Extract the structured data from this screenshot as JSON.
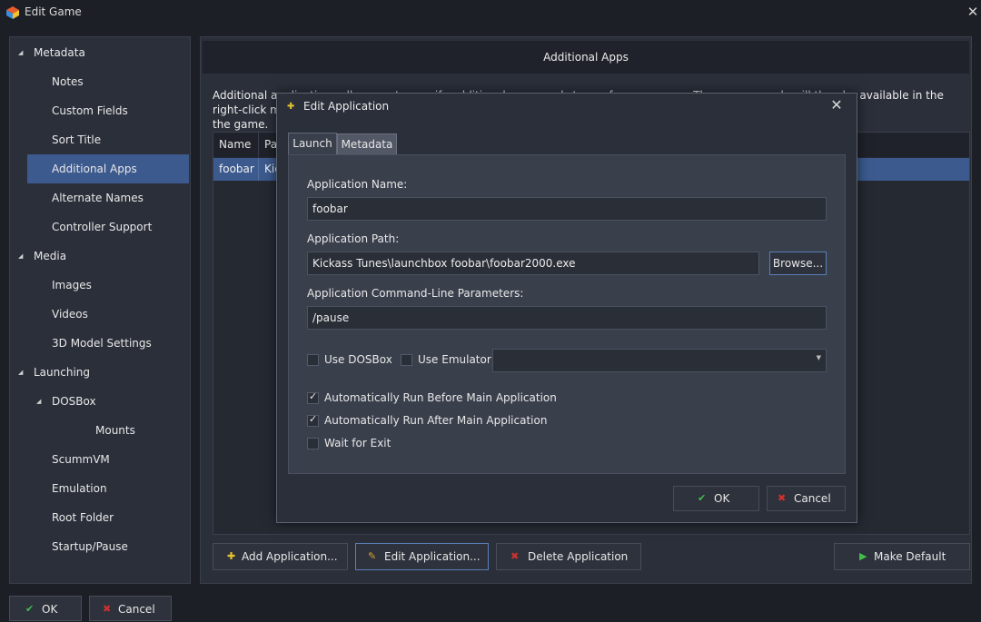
{
  "window": {
    "title": "Edit Game",
    "close_glyph": "✕"
  },
  "sidebar": {
    "items": [
      {
        "label": "Metadata",
        "expanded": true,
        "level": 0
      },
      {
        "label": "Notes",
        "level": 1
      },
      {
        "label": "Custom Fields",
        "level": 1
      },
      {
        "label": "Sort Title",
        "level": 1
      },
      {
        "label": "Additional Apps",
        "level": 1,
        "selected": true
      },
      {
        "label": "Alternate Names",
        "level": 1
      },
      {
        "label": "Controller Support",
        "level": 1
      },
      {
        "label": "Media",
        "expanded": true,
        "level": 0
      },
      {
        "label": "Images",
        "level": 1
      },
      {
        "label": "Videos",
        "level": 1
      },
      {
        "label": "3D Model Settings",
        "level": 1
      },
      {
        "label": "Launching",
        "expanded": true,
        "level": 0
      },
      {
        "label": "DOSBox",
        "expanded": true,
        "level": 1
      },
      {
        "label": "Mounts",
        "level": 2
      },
      {
        "label": "ScummVM",
        "level": 1
      },
      {
        "label": "Emulation",
        "level": 1
      },
      {
        "label": "Root Folder",
        "level": 1
      },
      {
        "label": "Startup/Pause",
        "level": 1
      }
    ]
  },
  "main": {
    "header": "Additional Apps",
    "intro_line1": "Additional applications allow you to specify additional commands to run for your game. These commands will then be available in the right-click menu for",
    "intro_line2": "the game.",
    "table": {
      "columns": [
        "Name",
        "Path"
      ],
      "rows": [
        {
          "name": "foobar",
          "path": "Kickass Tunes\\launchbox foobar\\foobar2000.exe"
        }
      ]
    },
    "buttons": {
      "add": "Add Application...",
      "edit": "Edit Application...",
      "delete": "Delete Application",
      "make_default": "Make Default"
    }
  },
  "dialog": {
    "title": "Edit Application",
    "tabs": [
      "Launch",
      "Metadata"
    ],
    "active_tab": "Launch",
    "app_name_label": "Application Name:",
    "app_name_value": "foobar",
    "app_path_label": "Application Path:",
    "app_path_value": "Kickass Tunes\\launchbox foobar\\foobar2000.exe",
    "browse_label": "Browse...",
    "params_label": "Application Command-Line Parameters:",
    "params_value": "/pause",
    "use_dosbox_label": "Use DOSBox",
    "use_dosbox_checked": false,
    "use_emulator_label": "Use Emulator:",
    "use_emulator_checked": false,
    "emulator_value": "",
    "auto_before_label": "Automatically Run Before Main Application",
    "auto_before_checked": true,
    "auto_after_label": "Automatically Run After Main Application",
    "auto_after_checked": true,
    "wait_exit_label": "Wait for Exit",
    "wait_exit_checked": false,
    "ok_label": "OK",
    "cancel_label": "Cancel"
  },
  "footer": {
    "ok_label": "OK",
    "cancel_label": "Cancel"
  },
  "colors": {
    "accent": "#3c5a8e",
    "ok_icon": "#3fbf4a",
    "cancel_icon": "#d0312d",
    "add_icon": "#e4c231",
    "make_default_icon": "#3fbf4a",
    "edit_icon": "#d9a030"
  },
  "icons": {
    "app": "launchbox-icon",
    "close": "close-icon",
    "expand": "triangle-down-icon",
    "ok": "checkmark-icon",
    "cancel": "red-x-icon",
    "add": "plus-icon",
    "edit": "pencil-icon",
    "delete": "red-x-icon",
    "make_default": "play-arrow-icon",
    "dropdown": "chevron-down-icon"
  }
}
